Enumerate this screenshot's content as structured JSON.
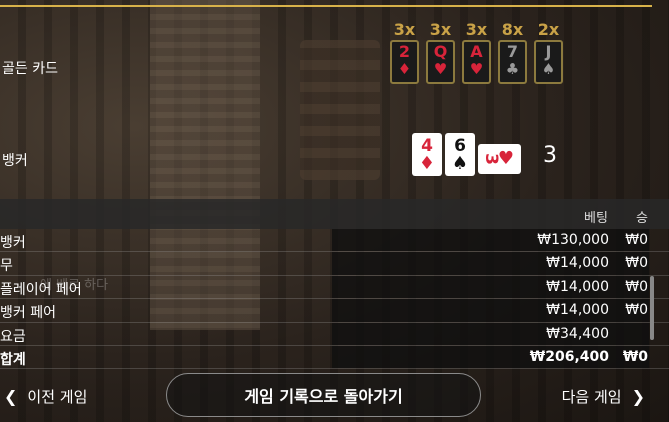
{
  "golden": {
    "label": "골든 카드",
    "multipliers": [
      "3x",
      "3x",
      "3x",
      "8x",
      "2x"
    ],
    "cards": [
      {
        "rank": "2",
        "suit": "♦",
        "color": "red"
      },
      {
        "rank": "Q",
        "suit": "♥",
        "color": "red"
      },
      {
        "rank": "A",
        "suit": "♥",
        "color": "red"
      },
      {
        "rank": "7",
        "suit": "♣",
        "color": "gray"
      },
      {
        "rank": "J",
        "suit": "♠",
        "color": "gray"
      }
    ]
  },
  "banker": {
    "label": "뱅커",
    "cards": [
      {
        "rank": "4",
        "suit": "♦",
        "color": "red"
      },
      {
        "rank": "6",
        "suit": "♠",
        "color": "black"
      },
      {
        "rank": "3",
        "suit": "♥",
        "color": "red"
      }
    ],
    "score": "3"
  },
  "table": {
    "headers": {
      "bet": "베팅",
      "win": "승"
    },
    "ghost_text": "에 베르 하다",
    "rows": [
      {
        "label": "뱅커",
        "bet": "₩130,000",
        "win": "₩0"
      },
      {
        "label": "무",
        "bet": "₩14,000",
        "win": "₩0"
      },
      {
        "label": "플레이어 페어",
        "bet": "₩14,000",
        "win": "₩0"
      },
      {
        "label": "뱅커 페어",
        "bet": "₩14,000",
        "win": "₩0"
      },
      {
        "label": "요금",
        "bet": "₩34,400",
        "win": ""
      },
      {
        "label": "합계",
        "bet": "₩206,400",
        "win": "₩0"
      }
    ]
  },
  "footer": {
    "prev_label": "이전 게임",
    "back_label": "게임 기록으로 돌아가기",
    "next_label": "다음 게임"
  },
  "colors": {
    "gold": "#c9a247",
    "red": "#d8243a",
    "accent_line": "#d8b24a"
  }
}
